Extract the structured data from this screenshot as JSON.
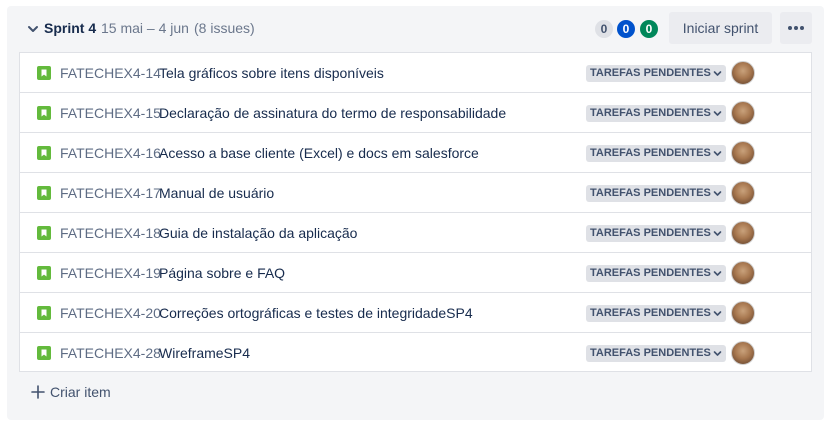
{
  "sprint": {
    "name": "Sprint 4",
    "dates": "15 mai – 4 jun",
    "issue_count": "(8 issues)",
    "counts": {
      "todo": "0",
      "in_progress": "0",
      "done": "0"
    },
    "start_button": "Iniciar sprint",
    "more_actions_icon": "more-horizontal-icon",
    "toggle_icon": "chevron-down-icon"
  },
  "colors": {
    "story_icon": "#63ba3c",
    "in_progress_badge": "#0052cc",
    "done_badge": "#00875a",
    "status_lozenge": "#dfe1e6"
  },
  "issues": [
    {
      "key": "FATECHEX4-14",
      "summary": "Tela gráficos sobre itens disponíveis",
      "status": "TAREFAS PENDENTES",
      "type_icon": "story-icon"
    },
    {
      "key": "FATECHEX4-15",
      "summary": "Declaração de assinatura do termo de responsabilidade",
      "status": "TAREFAS PENDENTES",
      "type_icon": "story-icon"
    },
    {
      "key": "FATECHEX4-16",
      "summary": "Acesso a base cliente (Excel) e docs em salesforce",
      "status": "TAREFAS PENDENTES",
      "type_icon": "story-icon"
    },
    {
      "key": "FATECHEX4-17",
      "summary": "Manual de usuário",
      "status": "TAREFAS PENDENTES",
      "type_icon": "story-icon"
    },
    {
      "key": "FATECHEX4-18",
      "summary": "Guia de instalação da aplicação",
      "status": "TAREFAS PENDENTES",
      "type_icon": "story-icon"
    },
    {
      "key": "FATECHEX4-19",
      "summary": "Página sobre e FAQ",
      "status": "TAREFAS PENDENTES",
      "type_icon": "story-icon"
    },
    {
      "key": "FATECHEX4-20",
      "summary": "Correções ortográficas e testes de integridadeSP4",
      "status": "TAREFAS PENDENTES",
      "type_icon": "story-icon"
    },
    {
      "key": "FATECHEX4-28",
      "summary": "WireframeSP4",
      "status": "TAREFAS PENDENTES",
      "type_icon": "story-icon"
    }
  ],
  "create_item": {
    "label": "Criar item",
    "icon": "plus-icon"
  }
}
